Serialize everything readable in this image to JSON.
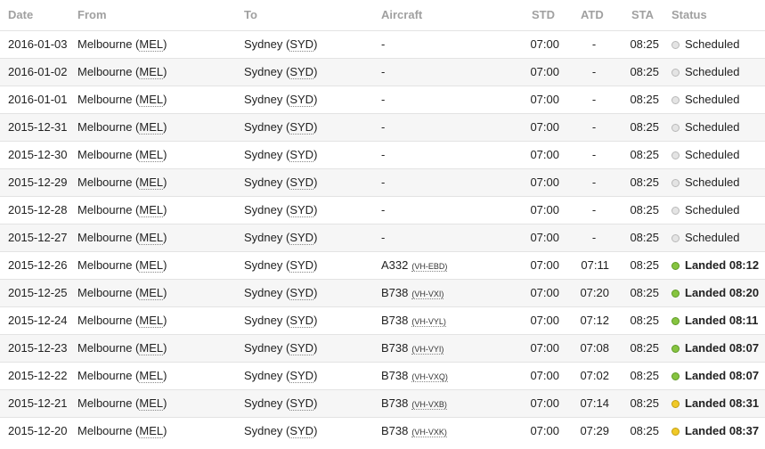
{
  "headers": {
    "date": "Date",
    "from": "From",
    "to": "To",
    "aircraft": "Aircraft",
    "std": "STD",
    "atd": "ATD",
    "sta": "STA",
    "status": "Status"
  },
  "rows": [
    {
      "date": "2016-01-03",
      "from_city": "Melbourne",
      "from_code": "MEL",
      "to_city": "Sydney",
      "to_code": "SYD",
      "aircraft": "-",
      "reg": "",
      "std": "07:00",
      "atd": "-",
      "sta": "08:25",
      "status": "Scheduled",
      "dot": "grey"
    },
    {
      "date": "2016-01-02",
      "from_city": "Melbourne",
      "from_code": "MEL",
      "to_city": "Sydney",
      "to_code": "SYD",
      "aircraft": "-",
      "reg": "",
      "std": "07:00",
      "atd": "-",
      "sta": "08:25",
      "status": "Scheduled",
      "dot": "grey"
    },
    {
      "date": "2016-01-01",
      "from_city": "Melbourne",
      "from_code": "MEL",
      "to_city": "Sydney",
      "to_code": "SYD",
      "aircraft": "-",
      "reg": "",
      "std": "07:00",
      "atd": "-",
      "sta": "08:25",
      "status": "Scheduled",
      "dot": "grey"
    },
    {
      "date": "2015-12-31",
      "from_city": "Melbourne",
      "from_code": "MEL",
      "to_city": "Sydney",
      "to_code": "SYD",
      "aircraft": "-",
      "reg": "",
      "std": "07:00",
      "atd": "-",
      "sta": "08:25",
      "status": "Scheduled",
      "dot": "grey"
    },
    {
      "date": "2015-12-30",
      "from_city": "Melbourne",
      "from_code": "MEL",
      "to_city": "Sydney",
      "to_code": "SYD",
      "aircraft": "-",
      "reg": "",
      "std": "07:00",
      "atd": "-",
      "sta": "08:25",
      "status": "Scheduled",
      "dot": "grey"
    },
    {
      "date": "2015-12-29",
      "from_city": "Melbourne",
      "from_code": "MEL",
      "to_city": "Sydney",
      "to_code": "SYD",
      "aircraft": "-",
      "reg": "",
      "std": "07:00",
      "atd": "-",
      "sta": "08:25",
      "status": "Scheduled",
      "dot": "grey"
    },
    {
      "date": "2015-12-28",
      "from_city": "Melbourne",
      "from_code": "MEL",
      "to_city": "Sydney",
      "to_code": "SYD",
      "aircraft": "-",
      "reg": "",
      "std": "07:00",
      "atd": "-",
      "sta": "08:25",
      "status": "Scheduled",
      "dot": "grey"
    },
    {
      "date": "2015-12-27",
      "from_city": "Melbourne",
      "from_code": "MEL",
      "to_city": "Sydney",
      "to_code": "SYD",
      "aircraft": "-",
      "reg": "",
      "std": "07:00",
      "atd": "-",
      "sta": "08:25",
      "status": "Scheduled",
      "dot": "grey"
    },
    {
      "date": "2015-12-26",
      "from_city": "Melbourne",
      "from_code": "MEL",
      "to_city": "Sydney",
      "to_code": "SYD",
      "aircraft": "A332",
      "reg": "(VH-EBD)",
      "std": "07:00",
      "atd": "07:11",
      "sta": "08:25",
      "status": "Landed 08:12",
      "dot": "green"
    },
    {
      "date": "2015-12-25",
      "from_city": "Melbourne",
      "from_code": "MEL",
      "to_city": "Sydney",
      "to_code": "SYD",
      "aircraft": "B738",
      "reg": "(VH-VXI)",
      "std": "07:00",
      "atd": "07:20",
      "sta": "08:25",
      "status": "Landed 08:20",
      "dot": "green"
    },
    {
      "date": "2015-12-24",
      "from_city": "Melbourne",
      "from_code": "MEL",
      "to_city": "Sydney",
      "to_code": "SYD",
      "aircraft": "B738",
      "reg": "(VH-VYL)",
      "std": "07:00",
      "atd": "07:12",
      "sta": "08:25",
      "status": "Landed 08:11",
      "dot": "green"
    },
    {
      "date": "2015-12-23",
      "from_city": "Melbourne",
      "from_code": "MEL",
      "to_city": "Sydney",
      "to_code": "SYD",
      "aircraft": "B738",
      "reg": "(VH-VYI)",
      "std": "07:00",
      "atd": "07:08",
      "sta": "08:25",
      "status": "Landed 08:07",
      "dot": "green"
    },
    {
      "date": "2015-12-22",
      "from_city": "Melbourne",
      "from_code": "MEL",
      "to_city": "Sydney",
      "to_code": "SYD",
      "aircraft": "B738",
      "reg": "(VH-VXQ)",
      "std": "07:00",
      "atd": "07:02",
      "sta": "08:25",
      "status": "Landed 08:07",
      "dot": "green"
    },
    {
      "date": "2015-12-21",
      "from_city": "Melbourne",
      "from_code": "MEL",
      "to_city": "Sydney",
      "to_code": "SYD",
      "aircraft": "B738",
      "reg": "(VH-VXB)",
      "std": "07:00",
      "atd": "07:14",
      "sta": "08:25",
      "status": "Landed 08:31",
      "dot": "yellow"
    },
    {
      "date": "2015-12-20",
      "from_city": "Melbourne",
      "from_code": "MEL",
      "to_city": "Sydney",
      "to_code": "SYD",
      "aircraft": "B738",
      "reg": "(VH-VXK)",
      "std": "07:00",
      "atd": "07:29",
      "sta": "08:25",
      "status": "Landed 08:37",
      "dot": "yellow"
    }
  ]
}
